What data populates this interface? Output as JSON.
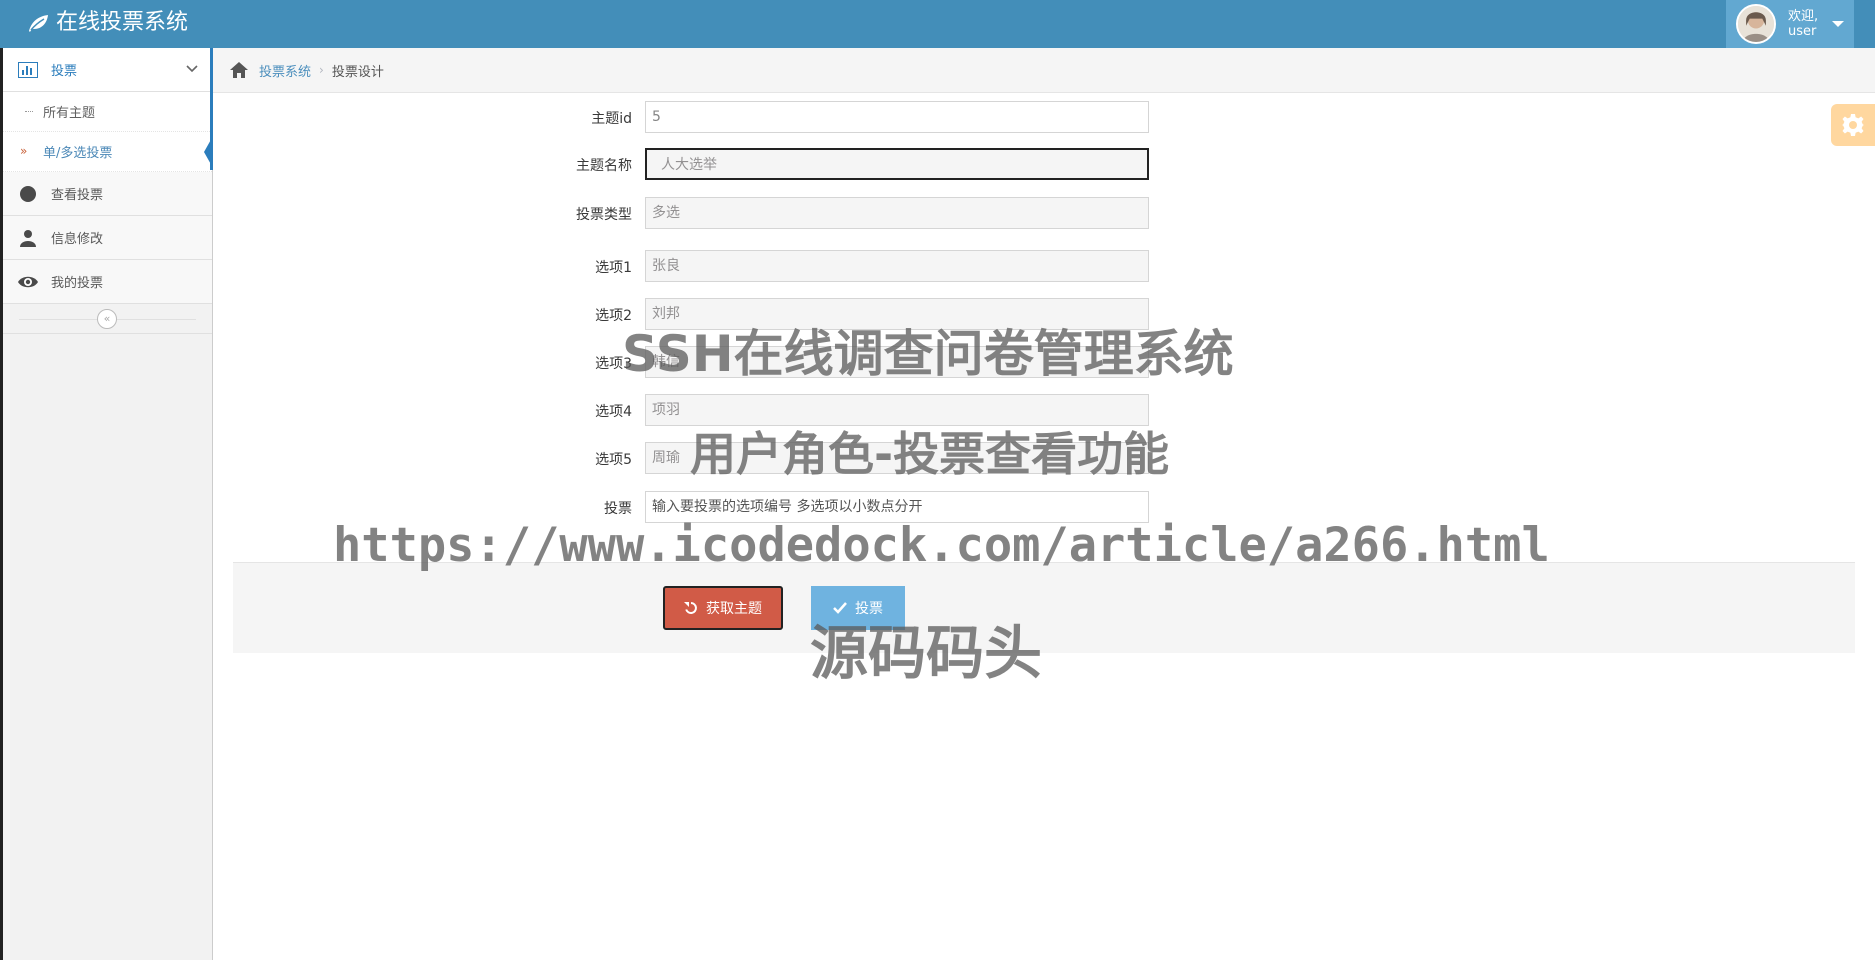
{
  "app": {
    "brand_title": "在线投票系统"
  },
  "user": {
    "greeting": "欢迎,",
    "name": "user"
  },
  "sidebar": {
    "menu_title": "投票",
    "sub_items": [
      {
        "label": "所有主题"
      },
      {
        "label": "单/多选投票"
      }
    ],
    "items": [
      {
        "label": "查看投票"
      },
      {
        "label": "信息修改"
      },
      {
        "label": "我的投票"
      }
    ],
    "collapse_icon": "«"
  },
  "breadcrumb": {
    "root": "投票系统",
    "separator": "›",
    "current": "投票设计"
  },
  "form": {
    "topic_id": {
      "label": "主题id",
      "value": "5"
    },
    "topic_name": {
      "label": "主题名称",
      "value": "人大选举"
    },
    "vote_type": {
      "label": "投票类型",
      "value": "多选"
    },
    "options": [
      {
        "label": "选项1",
        "value": "张良"
      },
      {
        "label": "选项2",
        "value": "刘邦"
      },
      {
        "label": "选项3",
        "value": "韩信"
      },
      {
        "label": "选项4",
        "value": "项羽"
      },
      {
        "label": "选项5",
        "value": "周瑜"
      }
    ],
    "vote": {
      "label": "投票",
      "placeholder": "输入要投票的选项编号 多选项以小数点分开"
    }
  },
  "actions": {
    "get_topic": "获取主题",
    "vote": "投票"
  },
  "watermark": {
    "line1": "SSH在线调查问卷管理系统",
    "line2": "用户角色-投票查看功能",
    "line3": "https://www.icodedock.com/article/a266.html",
    "line4": "源码码头"
  },
  "colors": {
    "navbar": "#438eb9",
    "accent": "#2b7dbc",
    "danger": "#d15b47",
    "info": "#6fb3e0",
    "warning": "#ffb752"
  }
}
